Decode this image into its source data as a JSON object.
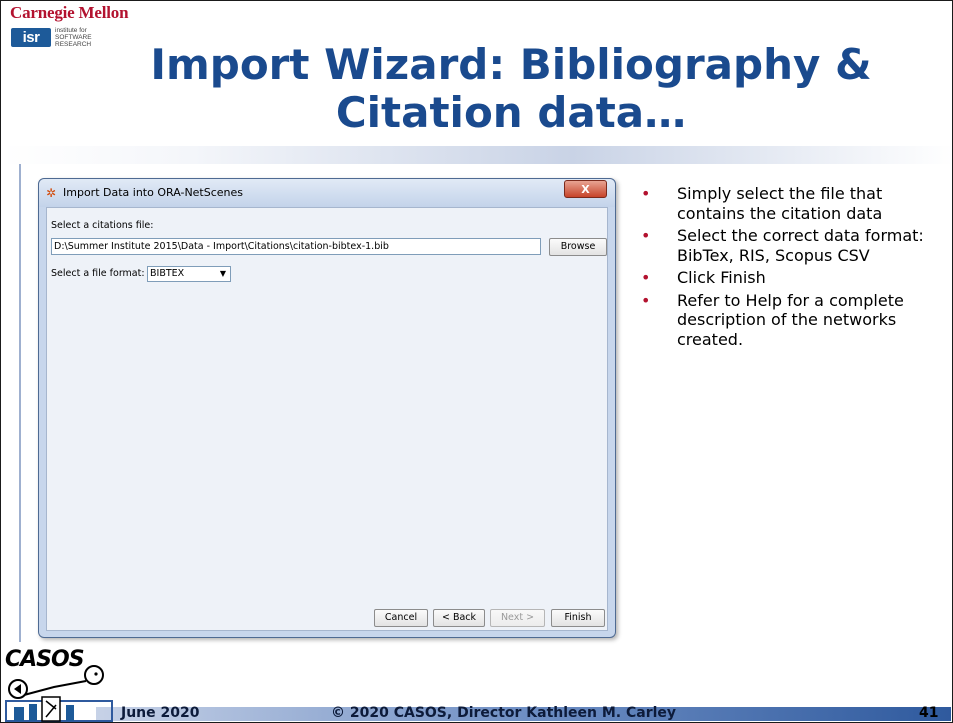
{
  "header": {
    "cmu_logo_text": "Carnegie Mellon",
    "isr_logo_text": "isr",
    "isr_tagline": [
      "institute for",
      "SOFTWARE",
      "RESEARCH"
    ],
    "title_line1": "Import Wizard: Bibliography &",
    "title_line2": "Citation data…"
  },
  "dialog": {
    "title": "Import Data into ORA-NetScenes",
    "close_label": "X",
    "citations_label": "Select a citations file:",
    "file_path": "D:\\Summer Institute 2015\\Data - Import\\Citations\\citation-bibtex-1.bib",
    "browse_label": "Browse",
    "format_label": "Select a file format:",
    "format_value": "BIBTEX",
    "buttons": {
      "cancel": "Cancel",
      "back": "< Back",
      "next": "Next >",
      "finish": "Finish"
    }
  },
  "bullets": [
    "Simply select the file that contains the citation data",
    "Select the correct data format: BibTex, RIS, Scopus CSV",
    "Click Finish",
    "Refer to Help for a complete description of the networks created."
  ],
  "footer": {
    "logo_text": "CASOS",
    "date": "June 2020",
    "copyright": "© 2020 CASOS, Director Kathleen M. Carley",
    "page_number": "41"
  },
  "colors": {
    "title": "#1a4a8e",
    "cmu_red": "#b3122f",
    "bullet": "#b3122f",
    "window_frame": "#c7d6ec",
    "close_button": "#c7442a"
  }
}
